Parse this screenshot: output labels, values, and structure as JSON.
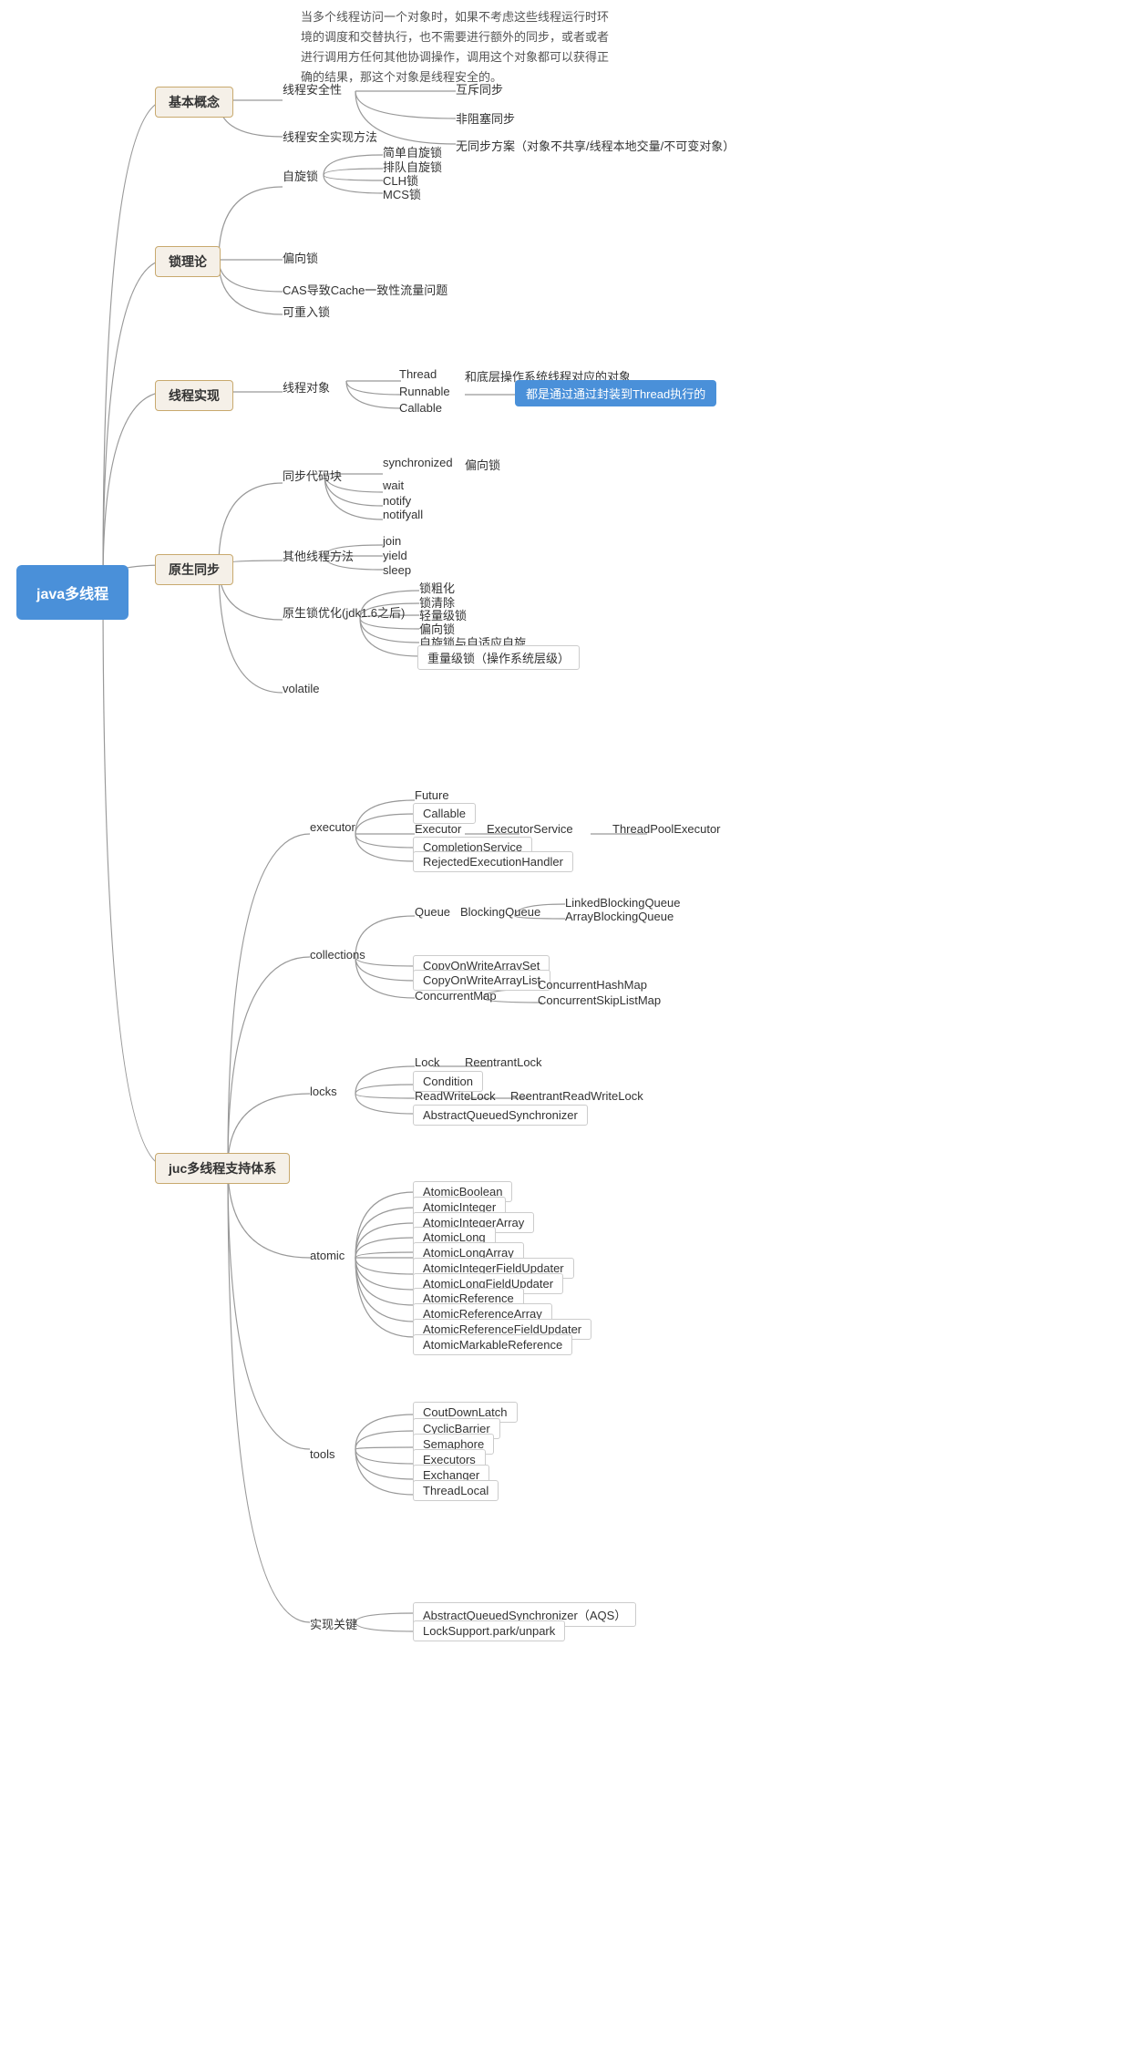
{
  "root": {
    "label": "java多线程"
  },
  "description": "当多个线程访问一个对象时，如果不考虑这些线程运行时环\n境的调度和交替执行，也不需要进行额外的同步，或者或者\n进行调用方任何其他协调操作，调用这个对象都可以获得正\n确的结果，那这个对象是线程安全的。",
  "nodes": {
    "jibenGainian": "基本概念",
    "suoLilun": "锁理论",
    "xianchengShixian": "线程实现",
    "yuanShengTongbu": "原生同步",
    "jucTixi": "juc多线程支持体系"
  }
}
